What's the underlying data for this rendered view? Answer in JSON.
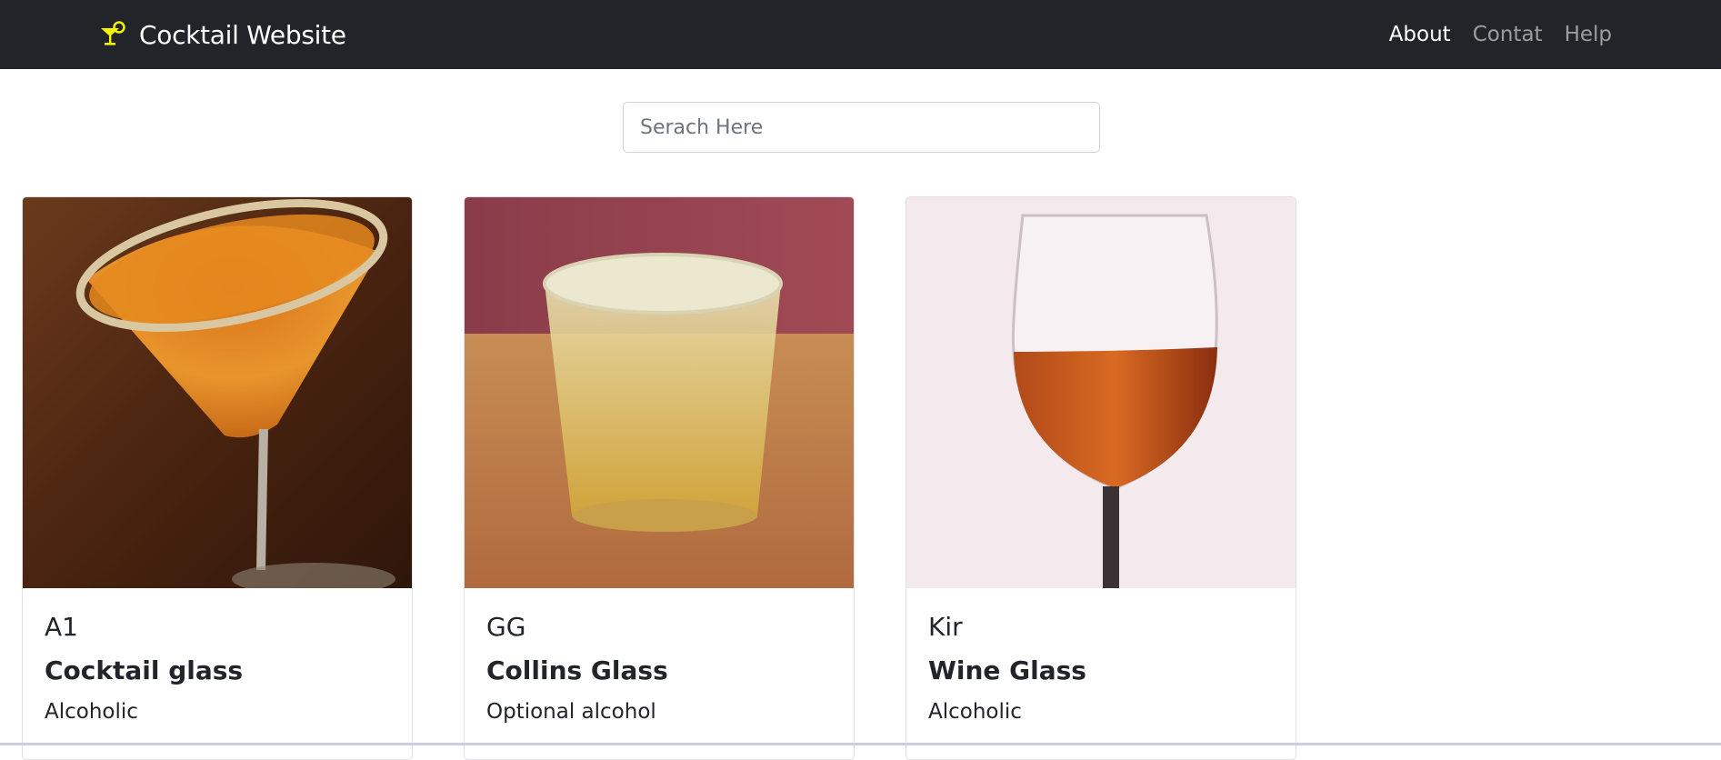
{
  "navbar": {
    "brand": "Cocktail Website",
    "brand_icon": "cocktail-icon",
    "brand_icon_color": "#ffff00",
    "links": [
      "About",
      "Contat",
      "Help"
    ],
    "active_link": "About",
    "background": "#212529"
  },
  "search": {
    "placeholder": "Serach Here",
    "value": ""
  },
  "cards": [
    {
      "name": "A1",
      "glass": "Cocktail glass",
      "alcoholic": "Alcoholic",
      "image": "cocktail-glass-drink-photo"
    },
    {
      "name": "GG",
      "glass": "Collins Glass",
      "alcoholic": "Optional alcohol",
      "image": "collins-glass-drink-photo"
    },
    {
      "name": "Kir",
      "glass": "Wine Glass",
      "alcoholic": "Alcoholic",
      "image": "wine-glass-drink-photo"
    }
  ]
}
